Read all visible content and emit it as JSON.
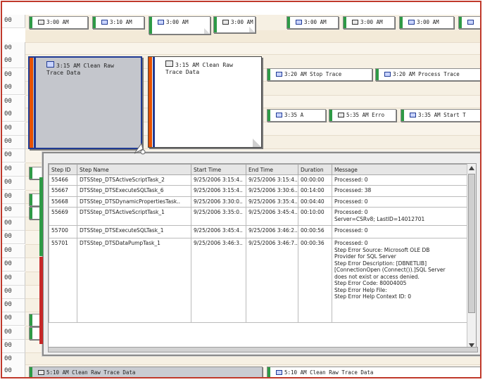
{
  "row_labels": [
    "00",
    "00",
    "00",
    "00",
    "00",
    "00",
    "00",
    "00",
    "00",
    "00",
    "00",
    "00",
    "00",
    "00",
    "00",
    "00",
    "00",
    "00",
    "00",
    "00",
    "00",
    "00",
    "00",
    "00",
    "00",
    "00",
    "00"
  ],
  "chips": [
    {
      "text": "3:00 AM",
      "icon": "doc"
    },
    {
      "text": "3:10 AM",
      "icon": "flag"
    },
    {
      "text": "3:00 AM",
      "icon": "flag"
    },
    {
      "text": "3:00 AM",
      "icon": "doc"
    },
    {
      "text": "3:00 AM",
      "icon": "flag"
    },
    {
      "text": "3:00 AM",
      "icon": "doc"
    },
    {
      "text": "3:00 AM",
      "icon": "flag"
    },
    {
      "text": "",
      "icon": "flag"
    },
    {
      "text": "3:20 AM Stop Trace",
      "icon": "flag"
    },
    {
      "text": "3:20 AM Process Trace",
      "icon": "flag"
    },
    {
      "text": "3:35 A",
      "icon": "flag"
    },
    {
      "text": "5:35 AM Erro",
      "icon": "doc"
    },
    {
      "text": "3:35 AM Start T",
      "icon": "flag"
    },
    {
      "text": "5:10 AM Clean Raw Trace Data",
      "icon": "doc"
    },
    {
      "text": "5:10 AM Clean Raw Trace Data",
      "icon": "flag"
    }
  ],
  "cards": [
    {
      "line1": "3:15 AM Clean Raw",
      "line2": "Trace Data"
    },
    {
      "line1": "3:15 AM Clean Raw",
      "line2": "Trace Data"
    }
  ],
  "grid": {
    "columns": [
      "Step ID",
      "Step Name",
      "Start Time",
      "End Time",
      "Duration",
      "Message"
    ],
    "rows": [
      {
        "id": "55466",
        "name": "DTSStep_DTSActiveScriptTask_2",
        "start": "9/25/2006 3:15:4..",
        "end": "9/25/2006 3:15:4..",
        "dur": "00:00:00",
        "msg": [
          "Processed: 0"
        ]
      },
      {
        "id": "55667",
        "name": "DTSStep_DTSExecuteSQLTask_6",
        "start": "9/25/2006 3:15:4..",
        "end": "9/25/2006 3:30:6..",
        "dur": "00:14:00",
        "msg": [
          "Processed: 38"
        ]
      },
      {
        "id": "55668",
        "name": "DTSStep_DTSDynamicPropertiesTask..",
        "start": "9/25/2006 3:30:0..",
        "end": "9/25/2006 3:35:4..",
        "dur": "00:04:40",
        "msg": [
          "Processed: 0"
        ]
      },
      {
        "id": "55669",
        "name": "DTSStep_DTSActiveScriptTask_1",
        "start": "9/25/2006 3:35:0..",
        "end": "9/25/2006 3:45:4..",
        "dur": "00:10:00",
        "msg": [
          "Processed: 0",
          "Server=CSRv8; LastID=14012701"
        ]
      },
      {
        "id": "55700",
        "name": "DTSStep_DTSExecuteSQLTask_1",
        "start": "9/25/2006 3:45:4..",
        "end": "9/25/2006 3:46:2..",
        "dur": "00:00:56",
        "msg": [
          "Processed: 0"
        ]
      },
      {
        "id": "55701",
        "name": "DTSStep_DTSDataPumpTask_1",
        "start": "9/25/2006 3:46:3..",
        "end": "9/25/2006 3:46:7..",
        "dur": "00:00:36",
        "msg": [
          "Processed: 0",
          "Step Error Source: Microsoft OLE DB",
          "Provider for SQL Server",
          "Step Error Description: [DBNETLIB]",
          "[ConnectionOpen (Connect()).]SQL Server",
          "does not exist or access denied.",
          "Step Error Code: 80004005",
          "Step Error Help File:",
          "Step Error Help Context ID: 0"
        ]
      }
    ]
  },
  "colors": {
    "frame": "#c0392b",
    "band": "#f6f0e3",
    "accent_green": "#2e9a46",
    "accent_blue": "#1f3a93",
    "accent_red": "#c62828",
    "accent_orange": "#e65100"
  }
}
